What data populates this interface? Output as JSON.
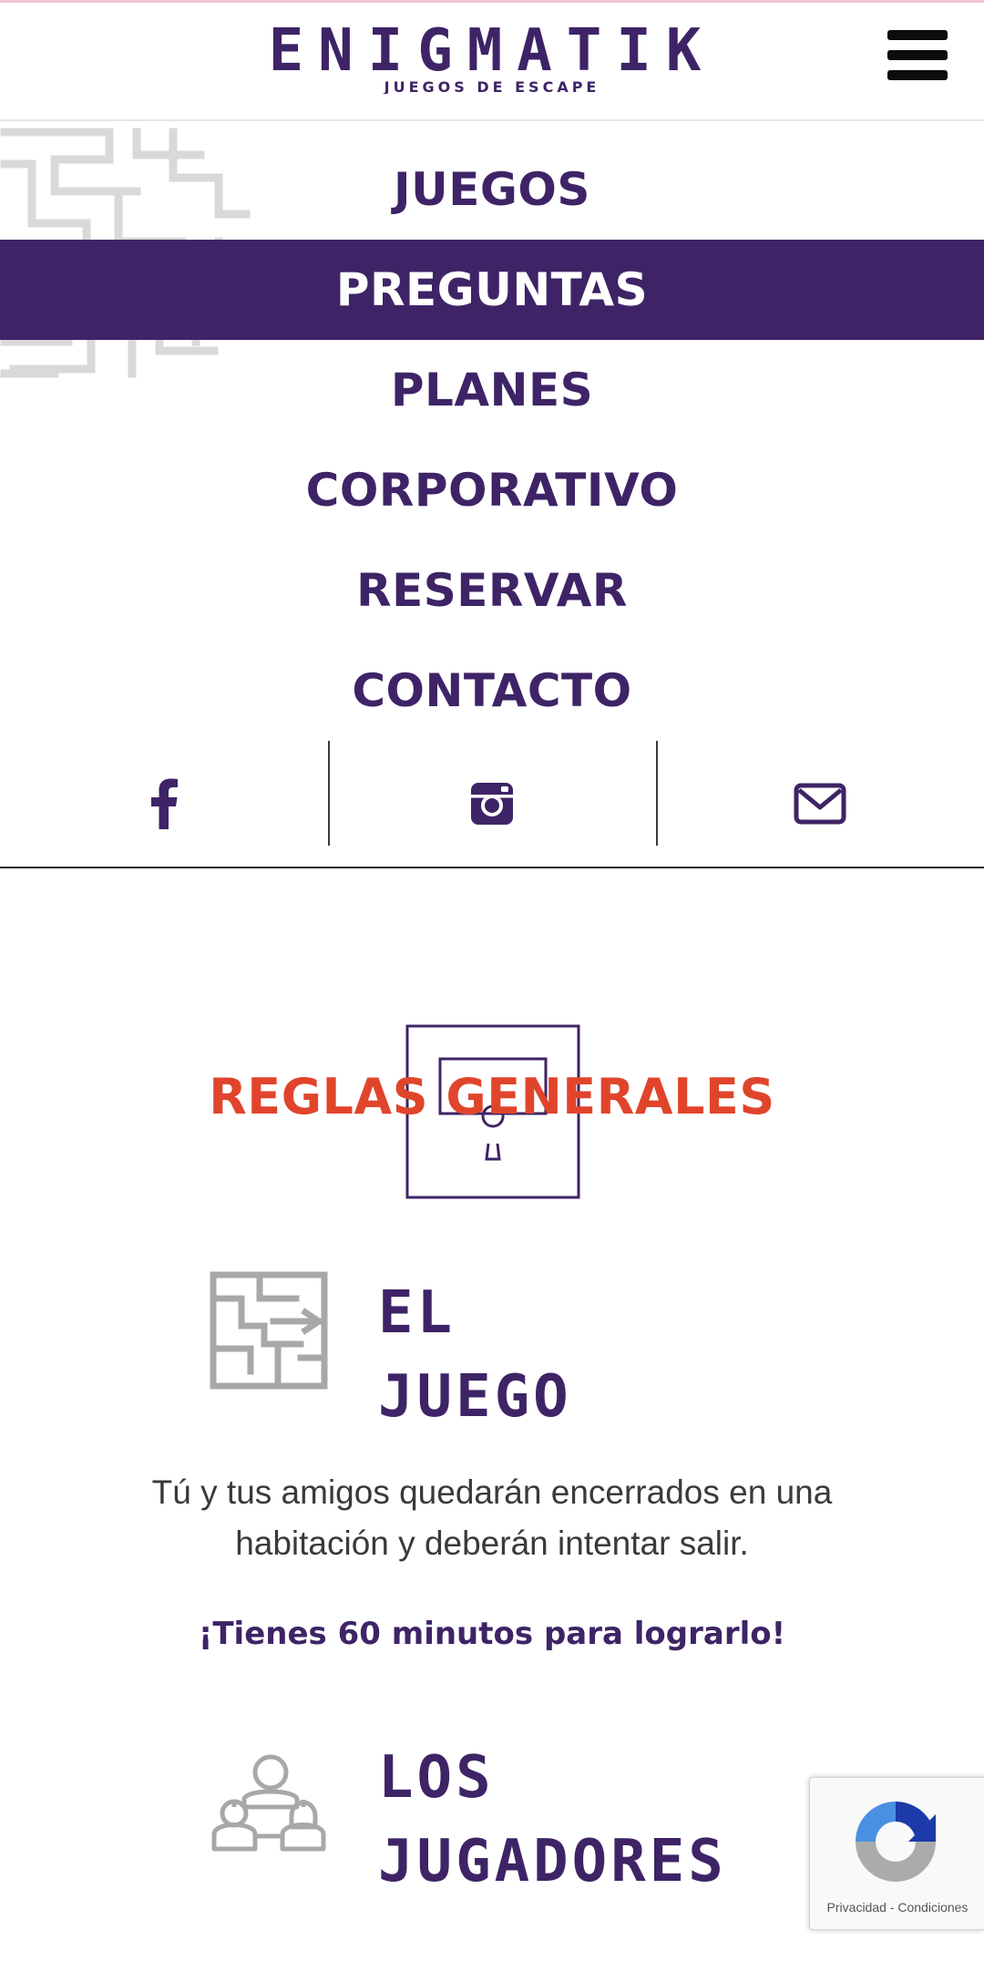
{
  "header": {
    "logo_text": "ENIGMATIK",
    "logo_subtitle": "JUEGOS DE ESCAPE",
    "menu_icon": "hamburger-icon"
  },
  "menu": {
    "items": [
      {
        "label": "JUEGOS",
        "active": false
      },
      {
        "label": "PREGUNTAS",
        "active": true
      },
      {
        "label": "PLANES",
        "active": false
      },
      {
        "label": "CORPORATIVO",
        "active": false
      },
      {
        "label": "RESERVAR",
        "active": false
      },
      {
        "label": "CONTACTO",
        "active": false
      }
    ]
  },
  "social": {
    "icons": [
      "facebook-icon",
      "instagram-icon",
      "envelope-icon"
    ]
  },
  "rules": {
    "title": "REGLAS GENERALES"
  },
  "game_section": {
    "title_line1": "EL",
    "title_line2": "JUEGO",
    "paragraph": "Tú y tus amigos quedarán encerrados en una habitación y deberán intentar salir.",
    "tagline": "¡Tienes 60 minutos para lograrlo!"
  },
  "players_section": {
    "title_line1": "LOS",
    "title_line2": "JUGADORES"
  },
  "recaptcha": {
    "privacy": "Privacidad",
    "separator": "-",
    "terms": "Condiciones"
  },
  "colors": {
    "brand_purple": "#3e2466",
    "accent_red": "#e0452c",
    "maze_gray": "#bdbdbd"
  }
}
